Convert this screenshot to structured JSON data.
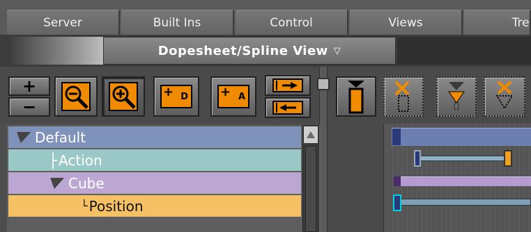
{
  "tabs": [
    "Server",
    "Built Ins",
    "Control",
    "Views",
    "Tree"
  ],
  "view": {
    "title": "Dopesheet/Spline View",
    "caret": "▽"
  },
  "toolbar": {
    "zoom_in_label": "+",
    "zoom_out_label": "−",
    "key_d_label": "D",
    "key_a_label": "A"
  },
  "tree": {
    "rows": [
      {
        "label": "Default",
        "prefix": "",
        "color": "#7f92b9"
      },
      {
        "label": "Action",
        "prefix": "├",
        "color": "#9ac8c7"
      },
      {
        "label": "Cube",
        "prefix": "",
        "color": "#bca7d3"
      },
      {
        "label": "Position",
        "prefix": "└",
        "color": "#f6c164"
      }
    ]
  },
  "tracks": [
    {
      "color": "#6c7fb0"
    },
    {
      "color": "#8fb2c2"
    },
    {
      "color": "#b49bd0"
    },
    {
      "color": "#7ea0b8"
    }
  ],
  "colors": {
    "accent": "#ff9900",
    "keyframe_blue": "#2a3a78",
    "keyframe_orange": "#f0a020",
    "keyframe_cyan": "#00d0e0"
  }
}
